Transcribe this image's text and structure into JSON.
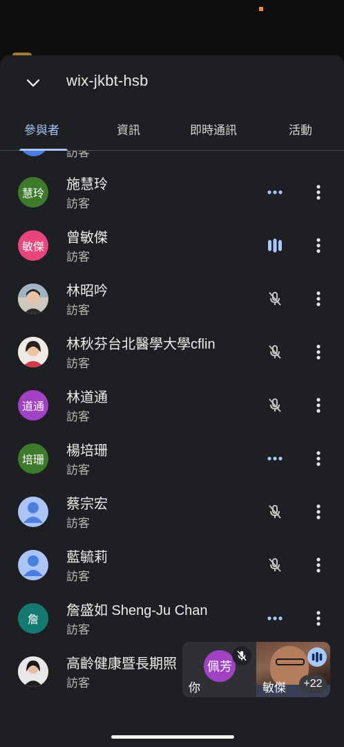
{
  "meeting": {
    "title": "wix-jkbt-hsb"
  },
  "tabs": [
    {
      "label": "參與者",
      "active": true
    },
    {
      "label": "資訊",
      "active": false
    },
    {
      "label": "即時通訊",
      "active": false
    },
    {
      "label": "活動",
      "active": false
    }
  ],
  "partial_row": {
    "role": "訪客"
  },
  "participants": [
    {
      "name": "施慧玲",
      "role": "訪客",
      "avatar_text": "慧玲",
      "avatar_color": "#3d7a2a",
      "status": "more-dots-icon"
    },
    {
      "name": "曾敏傑",
      "role": "訪客",
      "avatar_text": "敏傑",
      "avatar_color": "#e8457c",
      "status": "speaking-icon"
    },
    {
      "name": "林昭吟",
      "role": "訪客",
      "avatar_text": "",
      "avatar_color": "#d9d2c8",
      "status": "mic-off-icon"
    },
    {
      "name": "林秋芬台北醫學大學cflin",
      "role": "訪客",
      "avatar_text": "",
      "avatar_color": "#e4ddd7",
      "status": "mic-off-icon"
    },
    {
      "name": "林道通",
      "role": "訪客",
      "avatar_text": "道通",
      "avatar_color": "#a142c4",
      "status": "mic-off-icon"
    },
    {
      "name": "楊培珊",
      "role": "訪客",
      "avatar_text": "培珊",
      "avatar_color": "#3d7a2a",
      "status": "more-dots-icon"
    },
    {
      "name": "蔡宗宏",
      "role": "訪客",
      "avatar_text": "",
      "avatar_color": "#a9c4f5",
      "status": "mic-off-icon"
    },
    {
      "name": "藍毓莉",
      "role": "訪客",
      "avatar_text": "",
      "avatar_color": "#a9c4f5",
      "status": "mic-off-icon"
    },
    {
      "name": "詹盛如 Sheng-Ju Chan",
      "role": "訪客",
      "avatar_text": "詹",
      "avatar_color": "#137a72",
      "status": "more-dots-icon"
    },
    {
      "name": "高齡健康暨長期照",
      "role": "訪客",
      "avatar_text": "",
      "avatar_color": "#d8d8d8",
      "status": ""
    }
  ],
  "pip": {
    "self_avatar_text": "佩芳",
    "self_label": "你",
    "other_label": "敏傑",
    "others_count": "+22"
  },
  "colors": {
    "accent": "#a8c7fa",
    "sheet_bg": "#1e1f22"
  }
}
